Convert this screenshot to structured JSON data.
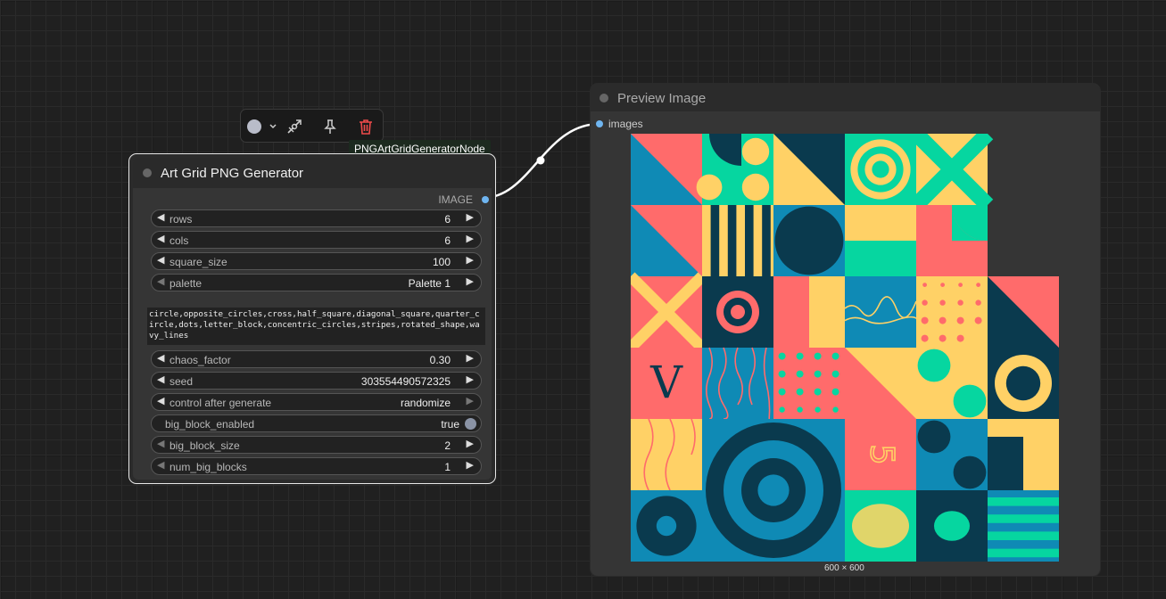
{
  "toolbar": {
    "color_icon": "color-circle-icon",
    "bypass_icon": "bypass-icon",
    "pin_icon": "pin-icon",
    "delete_icon": "trash-icon"
  },
  "tooltip": "PNGArtGridGeneratorNode",
  "node1": {
    "title": "Art Grid PNG Generator",
    "output_label": "IMAGE",
    "widgets": [
      {
        "label": "rows",
        "value": "6"
      },
      {
        "label": "cols",
        "value": "6"
      },
      {
        "label": "square_size",
        "value": "100"
      },
      {
        "label": "palette",
        "value": "Palette 1"
      }
    ],
    "textarea": "circle,opposite_circles,cross,half_square,diagonal_square,quarter_circle,dots,letter_block,concentric_circles,stripes,rotated_shape,wavy_lines",
    "widgets2": [
      {
        "label": "chaos_factor",
        "value": "0.30"
      },
      {
        "label": "seed",
        "value": "303554490572325"
      },
      {
        "label": "control after generate",
        "value": "randomize"
      },
      {
        "label": "big_block_enabled",
        "value": "true"
      },
      {
        "label": "big_block_size",
        "value": "2"
      },
      {
        "label": "num_big_blocks",
        "value": "1"
      }
    ]
  },
  "node2": {
    "title": "Preview Image",
    "input_label": "images",
    "caption": "600 × 600"
  },
  "art": {
    "letter": "V",
    "digit": "5",
    "palette": [
      "#0f8ab5",
      "#0a3a4e",
      "#ff6b6b",
      "#06d6a0",
      "#ffd166"
    ]
  }
}
